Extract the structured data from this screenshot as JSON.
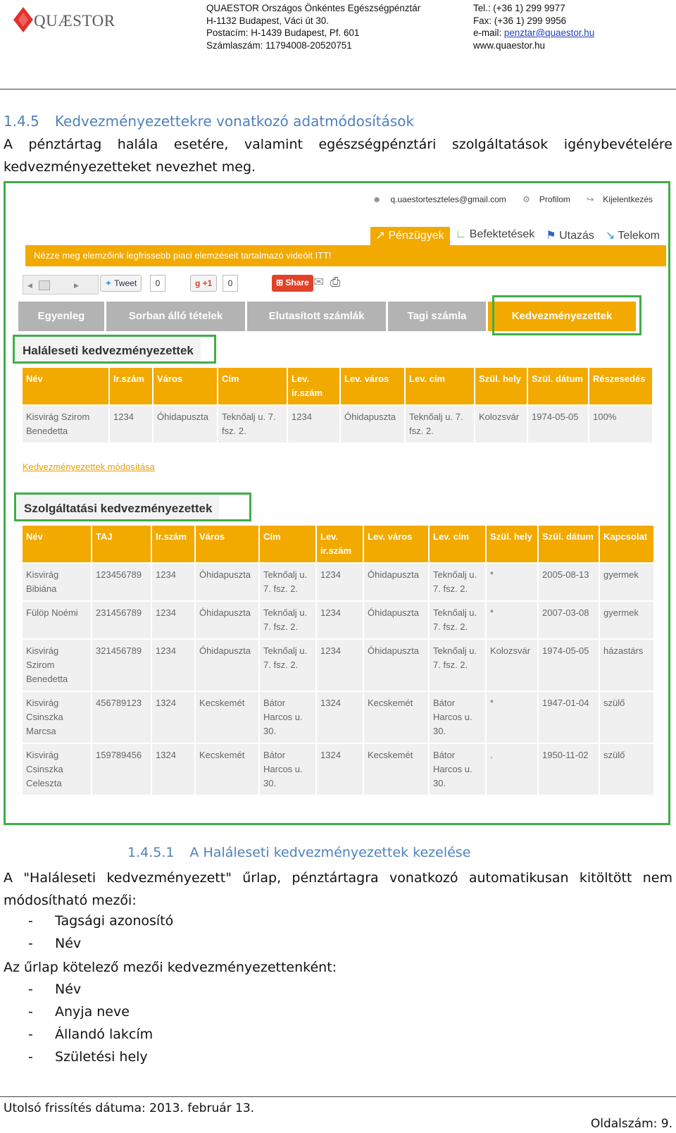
{
  "letterhead": {
    "logo_text": "QUÆSTOR",
    "brand_color": "#e4312b",
    "address_lines": [
      "QUAESTOR Országos Önkéntes Egészségpénztár",
      "H-1132 Budapest, Váci út 30.",
      "Postacím: H-1439 Budapest, Pf. 601",
      "Számlaszám: 11794008-20520751"
    ],
    "tel": "Tel.: (+36 1) 299 9977",
    "fax": "Fax: (+36 1) 299 9956",
    "email_label": "e-mail: ",
    "email": "penztar@quaestor.hu",
    "web": "www.quaestor.hu"
  },
  "section": {
    "number": "1.4.5",
    "title": "Kedvezményezettekre vonatkozó adatmódosítások",
    "intro": "A pénztártag halála esetére, valamint egészségpénztári szolgáltatások igénybevételére kedvezményezetteket nevezhet meg."
  },
  "screenshot": {
    "userbar": {
      "email": "q.uaestorteszteles@gmail.com",
      "profile": "Profilom",
      "logout": "Kijelentkezés"
    },
    "menu": [
      "Pénzügyek",
      "Befektetések",
      "Utazás",
      "Telekom"
    ],
    "banner": "Nézze meg elemzőink legfrissebb piaci elemzéseit tartalmazó videóit ITT!",
    "social": {
      "tweet": "Tweet",
      "tweet_count": "0",
      "gplus": "+1",
      "gplus_count": "0",
      "share": "Share"
    },
    "tabs": [
      "Egyenleg",
      "Sorban álló tételek",
      "Elutasított számlák",
      "Tagi számla",
      "Kedvezményezettek"
    ],
    "death_section": {
      "title": "Haláleseti kedvezményezettek",
      "headers": [
        "Név",
        "Ir.szám",
        "Város",
        "Cím",
        "Lev. ir.szám",
        "Lev. város",
        "Lev. cím",
        "Szül. hely",
        "Szül. dátum",
        "Részesedés"
      ],
      "rows": [
        [
          "Kisvirág Szirom Benedetta",
          "1234",
          "Óhidapuszta",
          "Teknőalj u. 7. fsz. 2.",
          "1234",
          "Óhidapuszta",
          "Teknőalj u. 7. fsz. 2.",
          "Kolozsvár",
          "1974-05-05",
          "100%"
        ]
      ]
    },
    "modify_link": "Kedvezményezettek módosítása",
    "service_section": {
      "title": "Szolgáltatási kedvezményezettek",
      "headers": [
        "Név",
        "TAJ",
        "Ir.szám",
        "Város",
        "Cím",
        "Lev. ir.szám",
        "Lev. város",
        "Lev. cím",
        "Szül. hely",
        "Szül. dátum",
        "Kapcsolat"
      ],
      "rows": [
        [
          "Kisvirág Bibiána",
          "123456789",
          "1234",
          "Óhidapuszta",
          "Teknőalj u. 7. fsz. 2.",
          "1234",
          "Óhidapuszta",
          "Teknőalj u. 7. fsz. 2.",
          "*",
          "2005-08-13",
          "gyermek"
        ],
        [
          "Fülöp Noémi",
          "231456789",
          "1234",
          "Óhidapuszta",
          "Teknőalj u. 7. fsz. 2.",
          "1234",
          "Óhidapuszta",
          "Teknőalj u. 7. fsz. 2.",
          "*",
          "2007-03-08",
          "gyermek"
        ],
        [
          "Kisvirág Szirom Benedetta",
          "321456789",
          "1234",
          "Óhidapuszta",
          "Teknőalj u. 7. fsz. 2.",
          "1234",
          "Óhidapuszta",
          "Teknőalj u. 7. fsz. 2.",
          "Kolozsvár",
          "1974-05-05",
          "házastárs"
        ],
        [
          "Kisvirág Csinszka Marcsa",
          "456789123",
          "1324",
          "Kecskemét",
          "Bátor Harcos u. 30.",
          "1324",
          "Kecskemét",
          "Bátor Harcos u. 30.",
          "*",
          "1947-01-04",
          "szülő"
        ],
        [
          "Kisvirág Csinszka Celeszta",
          "159789456",
          "1324",
          "Kecskemét",
          "Bátor Harcos u. 30.",
          "1324",
          "Kecskemét",
          "Bátor Harcos u. 30.",
          ".",
          "1950-11-02",
          "szülő"
        ]
      ]
    },
    "accent_color": "#f2a900",
    "highlight_color": "#3fae49"
  },
  "subsection": {
    "number": "1.4.5.1",
    "title": "A Haláleseti kedvezményezettek kezelése",
    "para": "A \"Haláleseti kedvezményezett\" űrlap, pénztártagra vonatkozó automatikusan kitöltött nem módosítható mezői:",
    "readonly_fields": [
      "Tagsági azonosító",
      "Név"
    ],
    "required_intro": "Az űrlap kötelező mezői kedvezményezettenként:",
    "required_fields": [
      "Név",
      "Anyja neve",
      "Állandó lakcím",
      "Születési hely"
    ]
  },
  "footer": {
    "updated": "Utolsó frissítés dátuma: 2013. február 13.",
    "page": "Oldalszám: 9."
  }
}
